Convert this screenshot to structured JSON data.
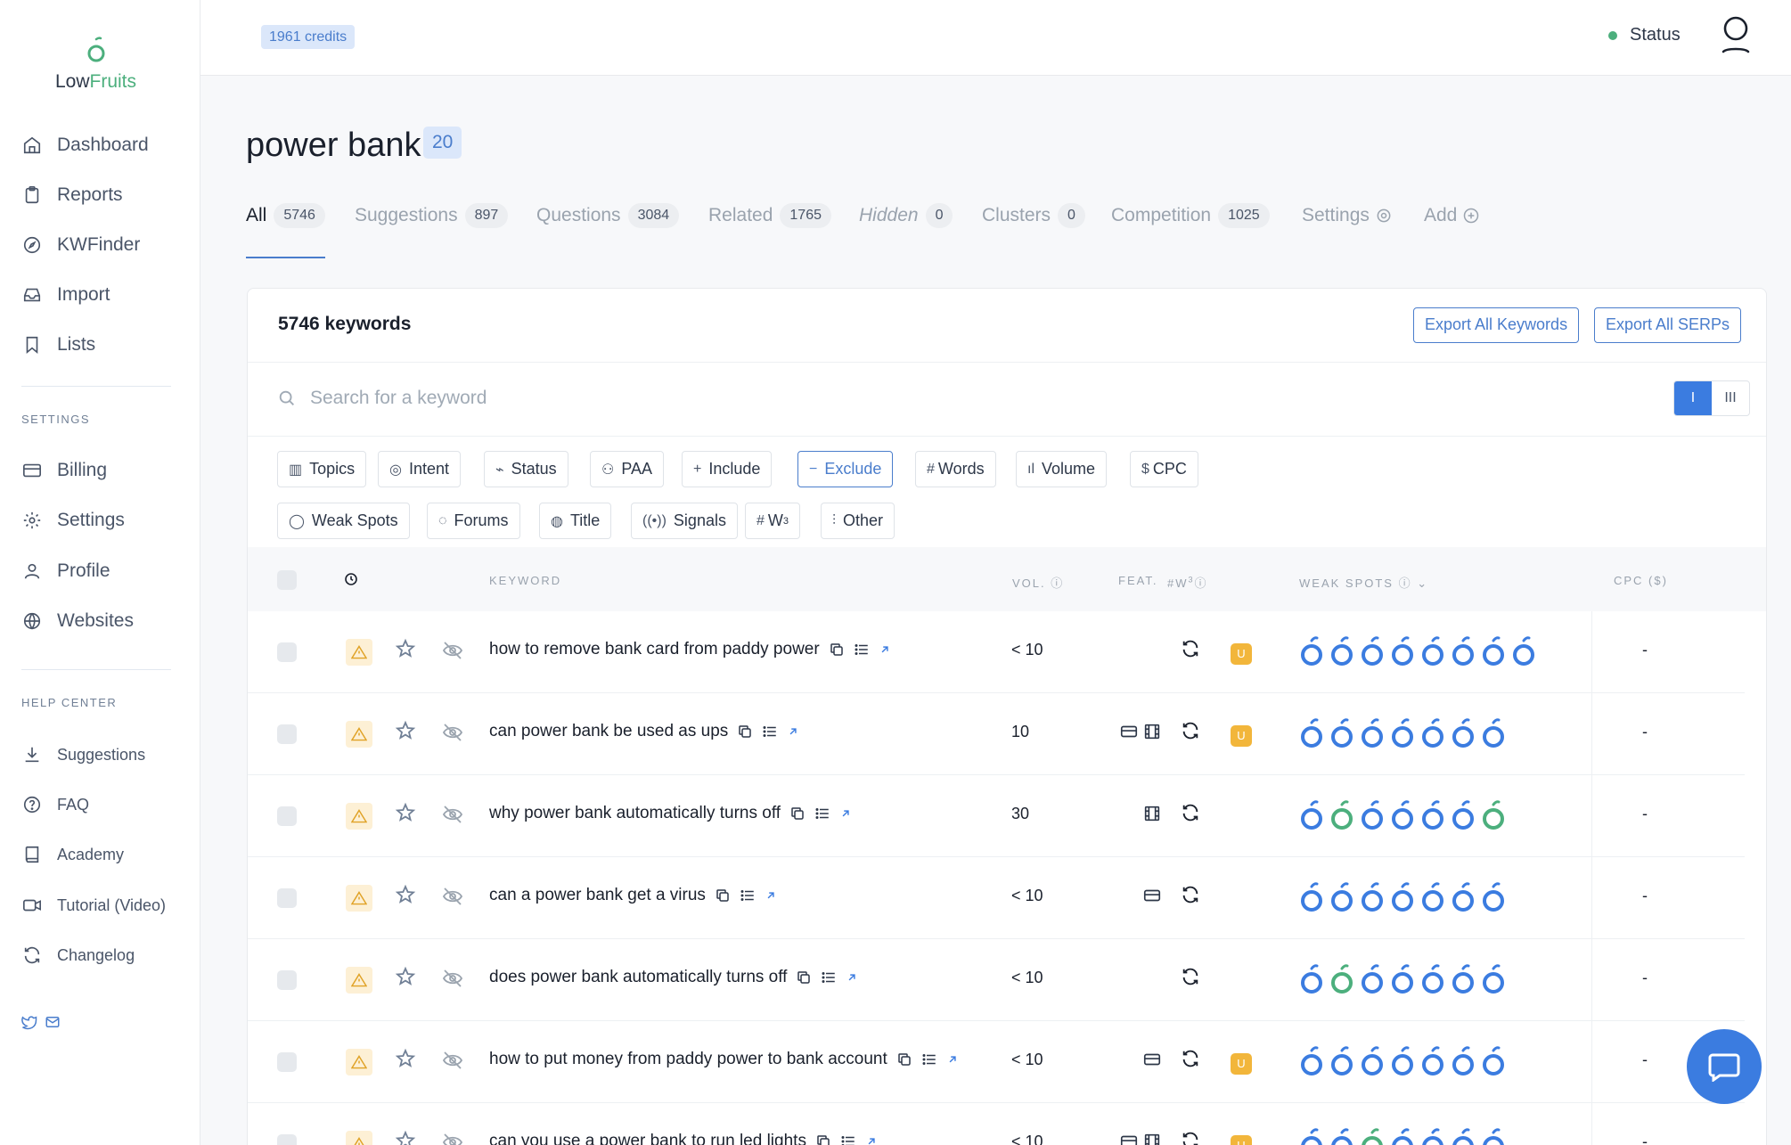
{
  "app": {
    "brand_prefix": "Low",
    "brand_suffix": "Fruits",
    "credits": "1961 credits",
    "status_label": "Status",
    "status_color": "#4caf7d",
    "accent_color": "#4a7dcc"
  },
  "sidebar": {
    "main": [
      {
        "label": "Dashboard",
        "icon": "home-icon"
      },
      {
        "label": "Reports",
        "icon": "clipboard-icon"
      },
      {
        "label": "KWFinder",
        "icon": "compass-icon"
      },
      {
        "label": "Import",
        "icon": "inbox-icon"
      },
      {
        "label": "Lists",
        "icon": "bookmark-icon"
      }
    ],
    "settings_heading": "SETTINGS",
    "settings": [
      {
        "label": "Billing",
        "icon": "credit-card-icon"
      },
      {
        "label": "Settings",
        "icon": "gear-icon"
      },
      {
        "label": "Profile",
        "icon": "user-icon"
      },
      {
        "label": "Websites",
        "icon": "globe-icon"
      }
    ],
    "help_heading": "HELP CENTER",
    "help": [
      {
        "label": "Suggestions",
        "icon": "download-icon"
      },
      {
        "label": "FAQ",
        "icon": "question-icon"
      },
      {
        "label": "Academy",
        "icon": "book-icon"
      },
      {
        "label": "Tutorial (Video)",
        "icon": "video-icon"
      },
      {
        "label": "Changelog",
        "icon": "refresh-icon"
      }
    ]
  },
  "page": {
    "title": "power bank",
    "title_count": "20"
  },
  "tabs": [
    {
      "label": "All",
      "count": "5746",
      "active": true
    },
    {
      "label": "Suggestions",
      "count": "897"
    },
    {
      "label": "Questions",
      "count": "3084"
    },
    {
      "label": "Related",
      "count": "1765"
    },
    {
      "label": "Hidden",
      "count": "0"
    },
    {
      "label": "Clusters",
      "count": "0"
    },
    {
      "label": "Competition",
      "count": "1025"
    },
    {
      "label": "Settings",
      "count": ""
    },
    {
      "label": "Add",
      "count": ""
    }
  ],
  "card": {
    "keyword_count": "5746 keywords",
    "export_keywords": "Export All Keywords",
    "export_serps": "Export All SERPs",
    "search_placeholder": "Search for a keyword",
    "view_single": "I",
    "view_multi": "III"
  },
  "filters_row1": [
    {
      "label": "Topics",
      "icon": "map-icon"
    },
    {
      "label": "Intent",
      "icon": "target-icon"
    },
    {
      "label": "Status",
      "icon": "activity-icon"
    },
    {
      "label": "PAA",
      "icon": "people-icon"
    },
    {
      "label": "Include",
      "icon": "plus-icon"
    },
    {
      "label": "Exclude",
      "icon": "minus-icon"
    },
    {
      "label": "Words",
      "icon": "hash-icon"
    },
    {
      "label": "Volume",
      "icon": "bar-icon"
    },
    {
      "label": "CPC",
      "icon": "dollar-icon"
    }
  ],
  "filters_row2": [
    {
      "label": "Weak Spots",
      "icon": "fruit-icon"
    },
    {
      "label": "Forums",
      "icon": "chat-icon"
    },
    {
      "label": "Title",
      "icon": "circle-icon"
    },
    {
      "label": "Signals",
      "icon": "signal-icon"
    },
    {
      "label": "W",
      "sup": "3",
      "icon": "hash-icon"
    },
    {
      "label": "Other",
      "icon": "sliders-icon"
    }
  ],
  "columns": {
    "keyword": "KEYWORD",
    "volume": "VOL.",
    "features": "FEAT.",
    "w3": "#W",
    "w3_sup": "3",
    "weak_spots": "WEAK SPOTS",
    "cpc": "CPC ($)"
  },
  "rows": [
    {
      "keyword": "how to remove bank card from paddy power",
      "volume": "< 10",
      "features": [],
      "badge": "U",
      "weak_spots": [
        "blue",
        "blue",
        "blue",
        "blue",
        "blue",
        "blue",
        "blue",
        "blue"
      ],
      "cpc": "-"
    },
    {
      "keyword": "can power bank be used as ups",
      "volume": "10",
      "features": [
        "card",
        "film"
      ],
      "badge": "U",
      "weak_spots": [
        "blue",
        "blue",
        "blue",
        "blue",
        "blue",
        "blue",
        "blue"
      ],
      "cpc": "-"
    },
    {
      "keyword": "why power bank automatically turns off",
      "volume": "30",
      "features": [
        "film"
      ],
      "badge": "",
      "weak_spots": [
        "blue",
        "green",
        "blue",
        "blue",
        "blue",
        "blue",
        "green"
      ],
      "cpc": "-"
    },
    {
      "keyword": "can a power bank get a virus",
      "volume": "< 10",
      "features": [
        "card"
      ],
      "badge": "",
      "weak_spots": [
        "blue",
        "blue",
        "blue",
        "blue",
        "blue",
        "blue",
        "blue"
      ],
      "cpc": "-"
    },
    {
      "keyword": "does power bank automatically turns off",
      "volume": "< 10",
      "features": [],
      "badge": "",
      "weak_spots": [
        "blue",
        "green",
        "blue",
        "blue",
        "blue",
        "blue",
        "blue"
      ],
      "cpc": "-"
    },
    {
      "keyword": "how to put money from paddy power to bank account",
      "volume": "< 10",
      "features": [
        "card"
      ],
      "badge": "U",
      "weak_spots": [
        "blue",
        "blue",
        "blue",
        "blue",
        "blue",
        "blue",
        "blue"
      ],
      "cpc": "-"
    },
    {
      "keyword": "can you use a power bank to run led lights",
      "volume": "< 10",
      "features": [
        "card",
        "film"
      ],
      "badge": "U",
      "weak_spots": [
        "blue",
        "blue",
        "green",
        "blue",
        "blue",
        "blue",
        "blue"
      ],
      "cpc": "-"
    }
  ],
  "fruit_colors": {
    "blue": "#3b7ce0",
    "green": "#4caf7d"
  }
}
